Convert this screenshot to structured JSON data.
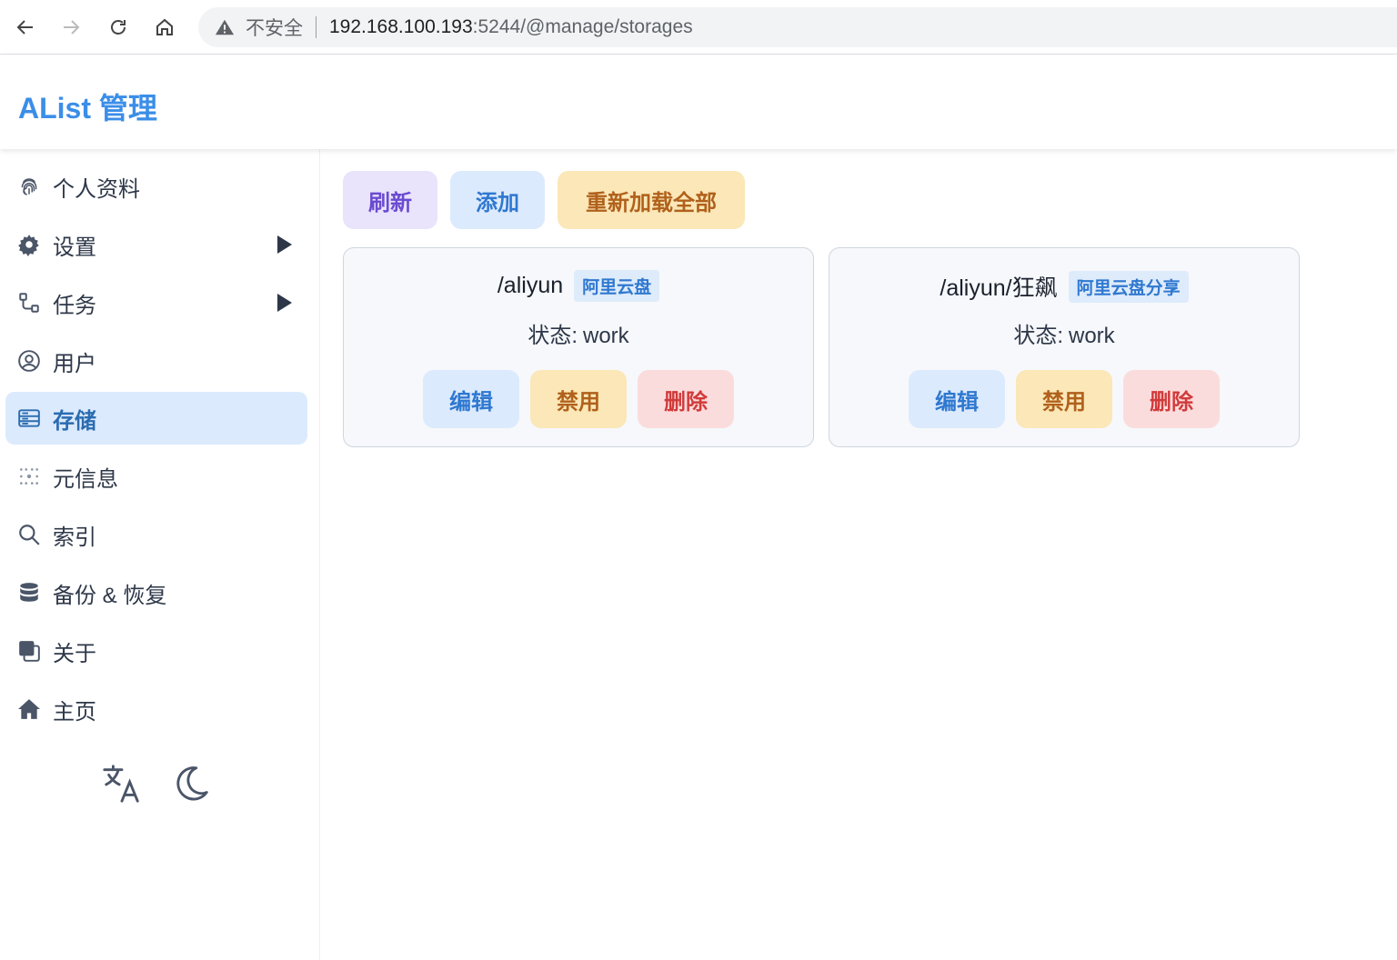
{
  "browser": {
    "insecure_label": "不安全",
    "url_host": "192.168.100.193",
    "url_rest": ":5244/@manage/storages"
  },
  "header": {
    "title": "AList 管理"
  },
  "sidebar": {
    "items": [
      {
        "label": "个人资料",
        "icon": "fingerprint-icon"
      },
      {
        "label": "设置",
        "icon": "gear-icon",
        "expandable": true
      },
      {
        "label": "任务",
        "icon": "task-flow-icon",
        "expandable": true
      },
      {
        "label": "用户",
        "icon": "user-circle-icon"
      },
      {
        "label": "存储",
        "icon": "storage-icon",
        "active": true
      },
      {
        "label": "元信息",
        "icon": "meta-icon"
      },
      {
        "label": "索引",
        "icon": "search-icon"
      },
      {
        "label": "备份 & 恢复",
        "icon": "database-icon"
      },
      {
        "label": "关于",
        "icon": "copy-icon"
      },
      {
        "label": "主页",
        "icon": "home-icon"
      }
    ],
    "tools": [
      "translate-icon",
      "moon-icon"
    ]
  },
  "toolbar": {
    "refresh": "刷新",
    "add": "添加",
    "reload_all": "重新加载全部"
  },
  "storages": [
    {
      "mount": "/aliyun",
      "driver": "阿里云盘",
      "status_label": "状态:",
      "status": "work",
      "edit": "编辑",
      "disable": "禁用",
      "delete": "删除"
    },
    {
      "mount": "/aliyun/狂飙",
      "driver": "阿里云盘分享",
      "status_label": "状态:",
      "status": "work",
      "edit": "编辑",
      "disable": "禁用",
      "delete": "删除"
    }
  ],
  "colors": {
    "accent": "#3b8ee8",
    "active_bg": "#dceafd",
    "purple_btn": "#e9e3fb",
    "orange_btn": "#fbe7b7",
    "red_btn": "#fbdcdc"
  }
}
